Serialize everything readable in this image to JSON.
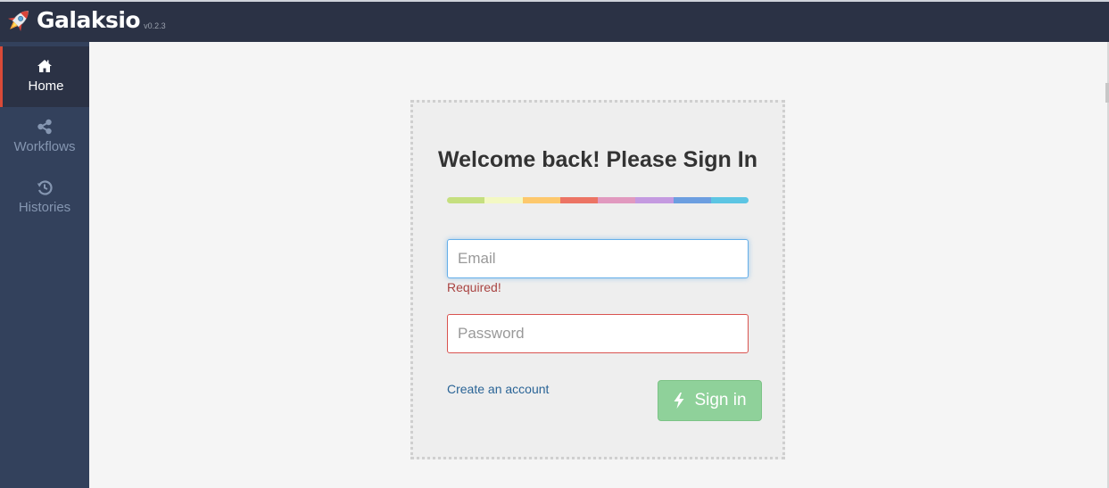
{
  "app": {
    "name": "Galaksio",
    "version": "v0.2.3",
    "logo_icon": "rocket-icon"
  },
  "sidebar": {
    "items": [
      {
        "label": "Home",
        "icon": "home-icon",
        "active": true
      },
      {
        "label": "Workflows",
        "icon": "share-icon",
        "active": false
      },
      {
        "label": "Histories",
        "icon": "history-icon",
        "active": false
      }
    ]
  },
  "login": {
    "title": "Welcome back! Please Sign In",
    "rainbow_colors": [
      "#c5df7f",
      "#f3f8c3",
      "#fdc86c",
      "#ec7464",
      "#e199bf",
      "#c49ae0",
      "#6c9ee0",
      "#5cc5e3"
    ],
    "email_placeholder": "Email",
    "email_error": "Required!",
    "password_placeholder": "Password",
    "create_account_label": "Create an account",
    "sign_in_label": "Sign in",
    "sign_in_icon": "bolt-icon"
  },
  "colors": {
    "topbar": "#2b3245",
    "sidebar": "#33415c",
    "active_accent": "#d94a38",
    "button": "#8fd19a",
    "error": "#a94442",
    "link": "#2a6496"
  }
}
